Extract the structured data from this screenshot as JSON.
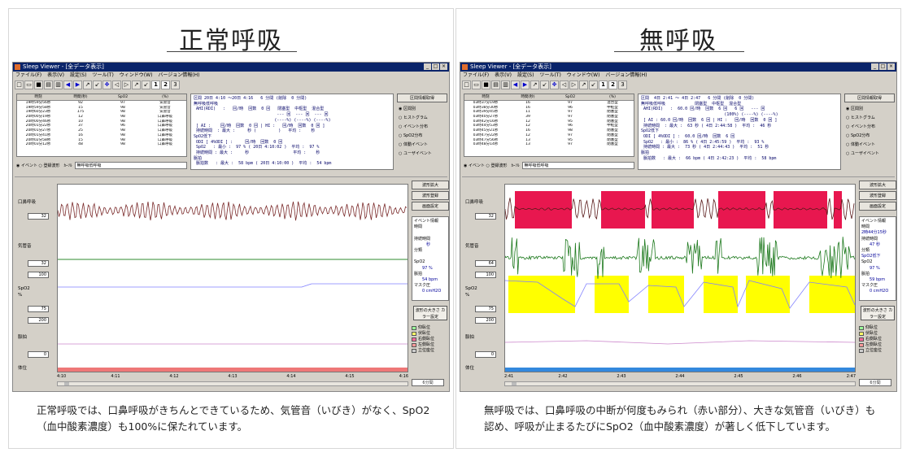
{
  "left": {
    "title": "正常呼吸",
    "caption": "正常呼吸では、口鼻呼吸がきちんとできているため、気管音（いびき）がなく、SpO2（血中酸素濃度）も100%に保たれています。",
    "window_title": "Sleep Viewer - [全データ表示]",
    "menu": [
      "ファイル(F)",
      "表示(V)",
      "設定(S)",
      "ツール(T)",
      "ウィンドウ(W)",
      "バージョン情報(H)"
    ],
    "list_headers": [
      "時刻",
      "時間(秒)",
      "SpO2",
      "(%)"
    ],
    "list_rows": [
      [
        "19時59分56秒",
        "92",
        "97",
        "気管音"
      ],
      [
        "19時59分58秒",
        "15",
        "98",
        "気管音"
      ],
      [
        "19時60分23秒",
        "175",
        "98",
        "気管音"
      ],
      [
        "20時00分19秒",
        "12",
        "98",
        "口鼻呼吸"
      ],
      [
        "20時00分46秒",
        "10",
        "98",
        "口鼻呼吸"
      ],
      [
        "20時01分22秒",
        "37",
        "96",
        "口鼻呼吸"
      ],
      [
        "20時01分27秒",
        "25",
        "98",
        "口鼻呼吸"
      ],
      [
        "20時01分41秒",
        "16",
        "98",
        "口鼻呼吸"
      ],
      [
        "20時02分58秒",
        "15",
        "98",
        "口鼻呼吸"
      ],
      [
        "20時03分12秒",
        "48",
        "98",
        "口鼻呼吸"
      ]
    ],
    "row_select": "◉ イベント ○ 登録波形　ｶｰｿﾙ",
    "row_dropdown": "無呼吸低呼吸",
    "info_lines": [
      "区間 20日 4:10 ～20日 4:16   6 分間 (削除  0 分間)",
      "無呼吸低呼吸",
      " AHI(RDI)   :   回/時  回数  0 回   閉塞型  中枢型  混合型",
      "                                  --- 回  --- 回  --- 回",
      "                                 (----%) (----%) (----%)",
      " [ AI :    回/時  回数  0 回 | HI :   回/時  回数  0 回 ]",
      " 持続時間  : 最大 :     秒 (         )   平均 :    秒",
      "SpO2低下",
      " ODI [ 4%ODI ] :     回/時  回数  0 回",
      " SpO2   : 最小 :  97 % ( 20日 4:10:02 )  平均 :  97 %",
      " 持続時間 : 最大 :     秒                  平均 :    秒",
      "脈拍",
      " 脈拍数   : 最大 :  58 bpm ( 20日 4:10:00 )  平均 :  54 bpm"
    ],
    "ctl_buttons": [
      "区間情報取得"
    ],
    "ctl_radios": [
      "◉ 区間別",
      "○ ヒストグラム",
      "○ イベント分布",
      "○ SpO2分布",
      "○ 体動イベント",
      "○ ユーザイベント"
    ],
    "right_buttons": [
      "波形拡大",
      "波形登録",
      "画面設定"
    ],
    "event_info": [
      "イベント情報",
      "時間",
      "",
      "持続時間",
      "　　　秒",
      "分類",
      "",
      "SpO2",
      "　　97 %",
      "脈拍",
      "　　54 bpm",
      "マスク圧",
      "　　0 cmH2O"
    ],
    "color_button": "波形の大きさ カラー設定",
    "legend": [
      {
        "label": "仰臥位",
        "color": "#99ff99"
      },
      {
        "label": "伏臥位",
        "color": "#ffff66"
      },
      {
        "label": "右側臥位",
        "color": "#ff6699"
      },
      {
        "label": "左側臥位",
        "color": "#ff9999"
      },
      {
        "label": "立位座位",
        "color": "#cccccc"
      }
    ],
    "channels": [
      {
        "label": "口鼻呼吸",
        "value": "32"
      },
      {
        "label": "気管音",
        "value": "32"
      },
      {
        "label": "SpO2",
        "value": "100"
      },
      {
        "label": "%",
        "value": "75"
      },
      {
        "label": "脈拍",
        "value": "200"
      },
      {
        "label": "体位",
        "value": "0"
      }
    ],
    "time_ticks": [
      "4:10",
      "4:11",
      "4:12",
      "4:13",
      "4:14",
      "4:15",
      "4:16"
    ],
    "span_label": "6分間",
    "posture_color": "#ee7777"
  },
  "right": {
    "title": "無呼吸",
    "caption": "無呼吸では、口鼻呼吸の中断が何度もみられ（赤い部分）、大きな気管音（いびき）も認め、呼吸が止まるたびにSpO2（血中酸素濃度）が著しく低下しています。",
    "window_title": "Sleep Viewer - [全データ表示]",
    "menu": [
      "ファイル(F)",
      "表示(V)",
      "設定(S)",
      "ツール(T)",
      "ウィンドウ(W)",
      "バージョン情報(H)"
    ],
    "list_headers": [
      "時刻",
      "時間(秒)",
      "SpO2",
      "(%)"
    ],
    "list_rows": [
      [
        "03時37分19秒",
        "16",
        "97",
        "混合型"
      ],
      [
        "03時38分30秒",
        "16",
        "96",
        "中枢型"
      ],
      [
        "03時39分45秒",
        "11",
        "97",
        "閉塞型"
      ],
      [
        "03時40分27秒",
        "39",
        "97",
        "閉塞型"
      ],
      [
        "03時42分16秒",
        "12",
        "95",
        "閉塞型"
      ],
      [
        "03時44分53秒",
        "12",
        "96",
        "中枢型"
      ],
      [
        "03時45分21秒",
        "16",
        "98",
        "閉塞型"
      ],
      [
        "03時47分22秒",
        "12",
        "97",
        "閉塞型"
      ],
      [
        "03時47分56秒",
        "13",
        "95",
        "閉塞型"
      ],
      [
        "03時48分14秒",
        "13",
        "97",
        "閉塞型"
      ]
    ],
    "row_select": "◉ イベント ○ 登録波形　ｶｰｿﾙ",
    "row_dropdown": "無呼吸低呼吸",
    "info_lines": [
      "区間  4日 2:41 ～ 4日 2:47   6 分間 (削除  0 分間)",
      "無呼吸低呼吸            閉塞型  中枢型  混合型",
      " AHI(RDI)   :  60.0 回/時  回数  6 回   6 回   --- 回",
      "                                  (100%) (----%) (----%)",
      " [ AI : 60.0 回/時  回数  6 回 | HI :   回/時  回数  0 回 ]",
      " 持続時間  : 最大 :  63 秒 ( 4日 2:44:58 )  平均 :  46 秒",
      "SpO2低下",
      " ODI [ 4%ODI ] :  60.0 回/時  回数  6 回",
      " SpO2   : 最小 :  86 % ( 4日 2:45:59 )  平均 :  93 %",
      " 持続時間 : 最大 :  73 秒 ( 4日 2:44:43 )  平均 :  51 秒",
      "脈拍",
      " 脈拍数   : 最大 :  66 bpm ( 4日 2:42:23 )  平均 :  58 bpm"
    ],
    "ctl_buttons": [
      "区間情報取得"
    ],
    "ctl_radios": [
      "◉ 区間別",
      "○ ヒストグラム",
      "○ イベント分布",
      "○ SpO2分布",
      "○ 体動イベント",
      "○ ユーザイベント"
    ],
    "right_buttons": [
      "波形拡大",
      "波形登録",
      "画面設定"
    ],
    "event_info": [
      "イベント情報",
      "時間",
      "2時44分15秒",
      "持続時間",
      "　　47 秒",
      "分類",
      "SpO2低下",
      "SpO2",
      "　　97 %",
      "脈拍",
      "　　59 bpm",
      "マスク圧",
      "　　0 cmH2O"
    ],
    "color_button": "波形の大きさ カラー設定",
    "legend": [
      {
        "label": "仰臥位",
        "color": "#99ff99"
      },
      {
        "label": "伏臥位",
        "color": "#ffff66"
      },
      {
        "label": "右側臥位",
        "color": "#ff6699"
      },
      {
        "label": "左側臥位",
        "color": "#ff9999"
      },
      {
        "label": "立位座位",
        "color": "#cccccc"
      }
    ],
    "channels": [
      {
        "label": "口鼻呼吸",
        "value": "32"
      },
      {
        "label": "気管音",
        "value": "64"
      },
      {
        "label": "SpO2",
        "value": "100"
      },
      {
        "label": "%",
        "value": "75"
      },
      {
        "label": "脈拍",
        "value": "200"
      },
      {
        "label": "体位",
        "value": "0"
      }
    ],
    "time_ticks": [
      "2:41",
      "2:42",
      "2:43",
      "2:44",
      "2:45",
      "2:46",
      "2:47"
    ],
    "span_label": "6分間",
    "posture_color": "#3388dd",
    "apnea_color": "#e8174f",
    "desat_color": "#ffff00"
  }
}
